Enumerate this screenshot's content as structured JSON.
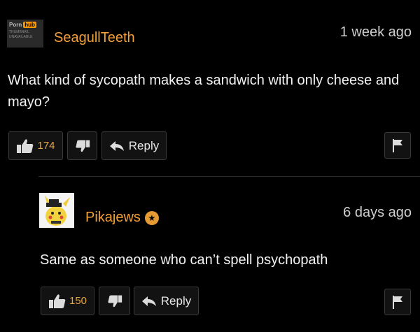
{
  "comments": [
    {
      "username": "SeagullTeeth",
      "time": "1 week ago",
      "text": "What kind of sycopath makes a sandwich with only cheese and mayo?",
      "likes": "174",
      "reply_label": "Reply",
      "avatar_text": [
        "Porn",
        "hub",
        "THUMBNAIL",
        "UNAVAILABLE"
      ]
    },
    {
      "username": "Pikajews",
      "time": "6 days ago",
      "text": "Same as someone who can’t spell psychopath",
      "likes": "150",
      "reply_label": "Reply",
      "badge_icon": "star-badge-icon"
    }
  ],
  "colors": {
    "username": "#f3a137",
    "count": "#e6a441",
    "background": "#000000"
  }
}
